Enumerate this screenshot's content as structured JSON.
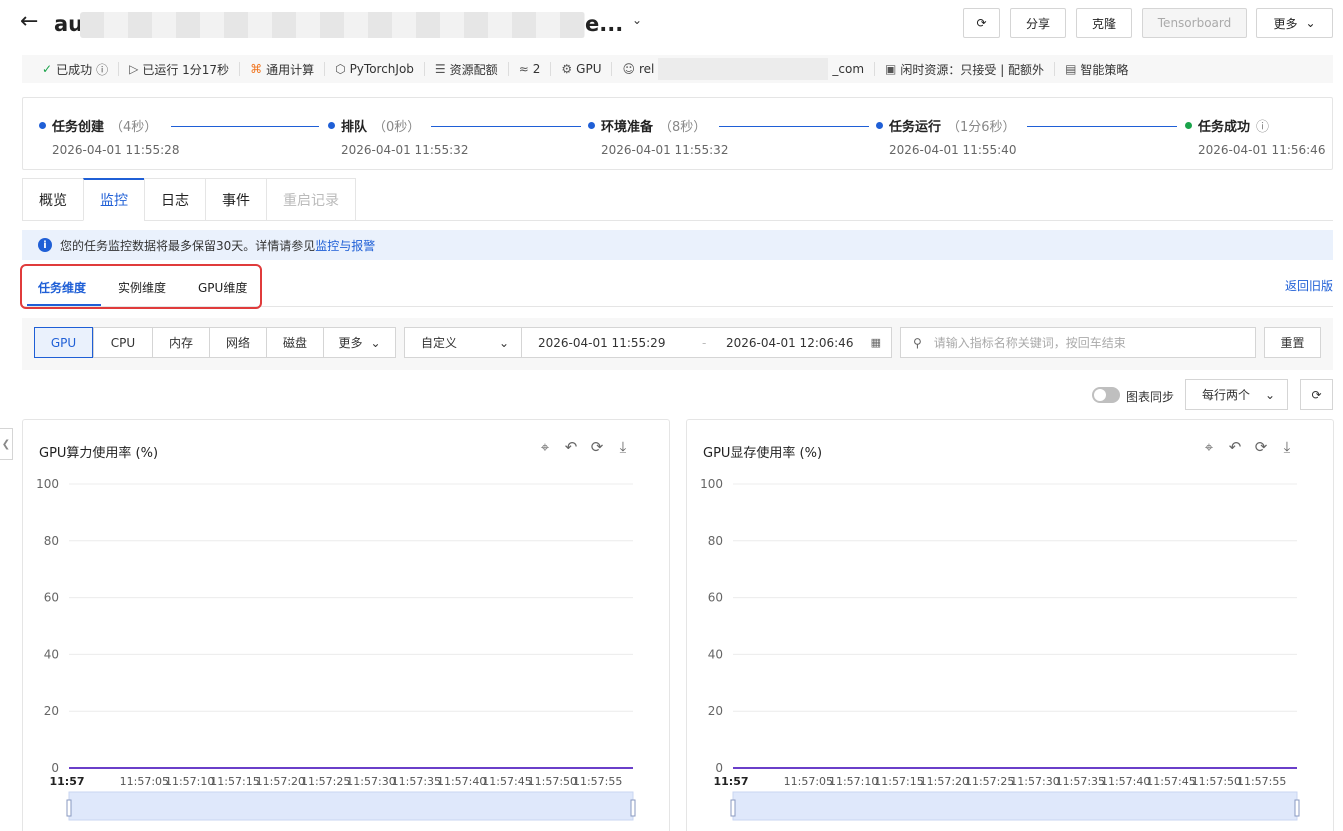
{
  "header": {
    "title_prefix": "au",
    "title_suffix": "e...",
    "buttons": {
      "refresh": "⟳",
      "share": "分享",
      "clone": "克隆",
      "tensorboard": "Tensorboard",
      "more": "更多"
    }
  },
  "meta": {
    "status": "已成功",
    "running": "已运行 1分17秒",
    "compute": "通用计算",
    "framework": "PyTorchJob",
    "quota": "资源配额",
    "nodes": "2",
    "gpu": "GPU",
    "user_prefix": "rel",
    "user_suffix": "_com",
    "idle": "闲时资源：只接受 | 配额外",
    "strategy": "智能策略"
  },
  "steps": [
    {
      "name": "任务创建",
      "dur": "（4秒）",
      "time": "2026-04-01 11:55:28"
    },
    {
      "name": "排队",
      "dur": "（0秒）",
      "time": "2026-04-01 11:55:32"
    },
    {
      "name": "环境准备",
      "dur": "（8秒）",
      "time": "2026-04-01 11:55:32"
    },
    {
      "name": "任务运行",
      "dur": "（1分6秒）",
      "time": "2026-04-01 11:55:40"
    },
    {
      "name": "任务成功",
      "dur": "",
      "time": "2026-04-01 11:56:46"
    }
  ],
  "tabs": [
    "概览",
    "监控",
    "日志",
    "事件",
    "重启记录"
  ],
  "notice": {
    "text": "您的任务监控数据将最多保留30天。详情请参见",
    "link": "监控与报警"
  },
  "subtabs": [
    "任务维度",
    "实例维度",
    "GPU维度"
  ],
  "old_version": "返回旧版",
  "filters": {
    "metrics": [
      "GPU",
      "CPU",
      "内存",
      "网络",
      "磁盘",
      "更多"
    ],
    "range": "自定义",
    "start": "2026-04-01 11:55:29",
    "end": "2026-04-01 12:06:46",
    "search_placeholder": "请输入指标名称关键词，按回车结束",
    "reset": "重置"
  },
  "toolbar": {
    "sync_label": "图表同步",
    "layout": "每行两个"
  },
  "charts": [
    {
      "title": "GPU算力使用率 (%)"
    },
    {
      "title": "GPU显存使用率 (%)"
    }
  ],
  "chart_data": [
    {
      "type": "line",
      "title": "GPU算力使用率 (%)",
      "ylim": [
        0,
        100
      ],
      "yticks": [
        0,
        20,
        40,
        60,
        80,
        100
      ],
      "x": [
        "11:57",
        "11:57:05",
        "11:57:10",
        "11:57:15",
        "11:57:20",
        "11:57:25",
        "11:57:30",
        "11:57:35",
        "11:57:40",
        "11:57:45",
        "11:57:50",
        "11:57:55"
      ],
      "series": [
        {
          "values": [
            0,
            0,
            0,
            0,
            0,
            0,
            0,
            0,
            0,
            0,
            0,
            0
          ]
        }
      ],
      "color": "#6a3fc9"
    },
    {
      "type": "line",
      "title": "GPU显存使用率 (%)",
      "ylim": [
        0,
        100
      ],
      "yticks": [
        0,
        20,
        40,
        60,
        80,
        100
      ],
      "x": [
        "11:57",
        "11:57:05",
        "11:57:10",
        "11:57:15",
        "11:57:20",
        "11:57:25",
        "11:57:30",
        "11:57:35",
        "11:57:40",
        "11:57:45",
        "11:57:50",
        "11:57:55"
      ],
      "series": [
        {
          "values": [
            0,
            0,
            0,
            0,
            0,
            0,
            0,
            0,
            0,
            0,
            0,
            0
          ]
        }
      ],
      "color": "#6a3fc9"
    }
  ]
}
